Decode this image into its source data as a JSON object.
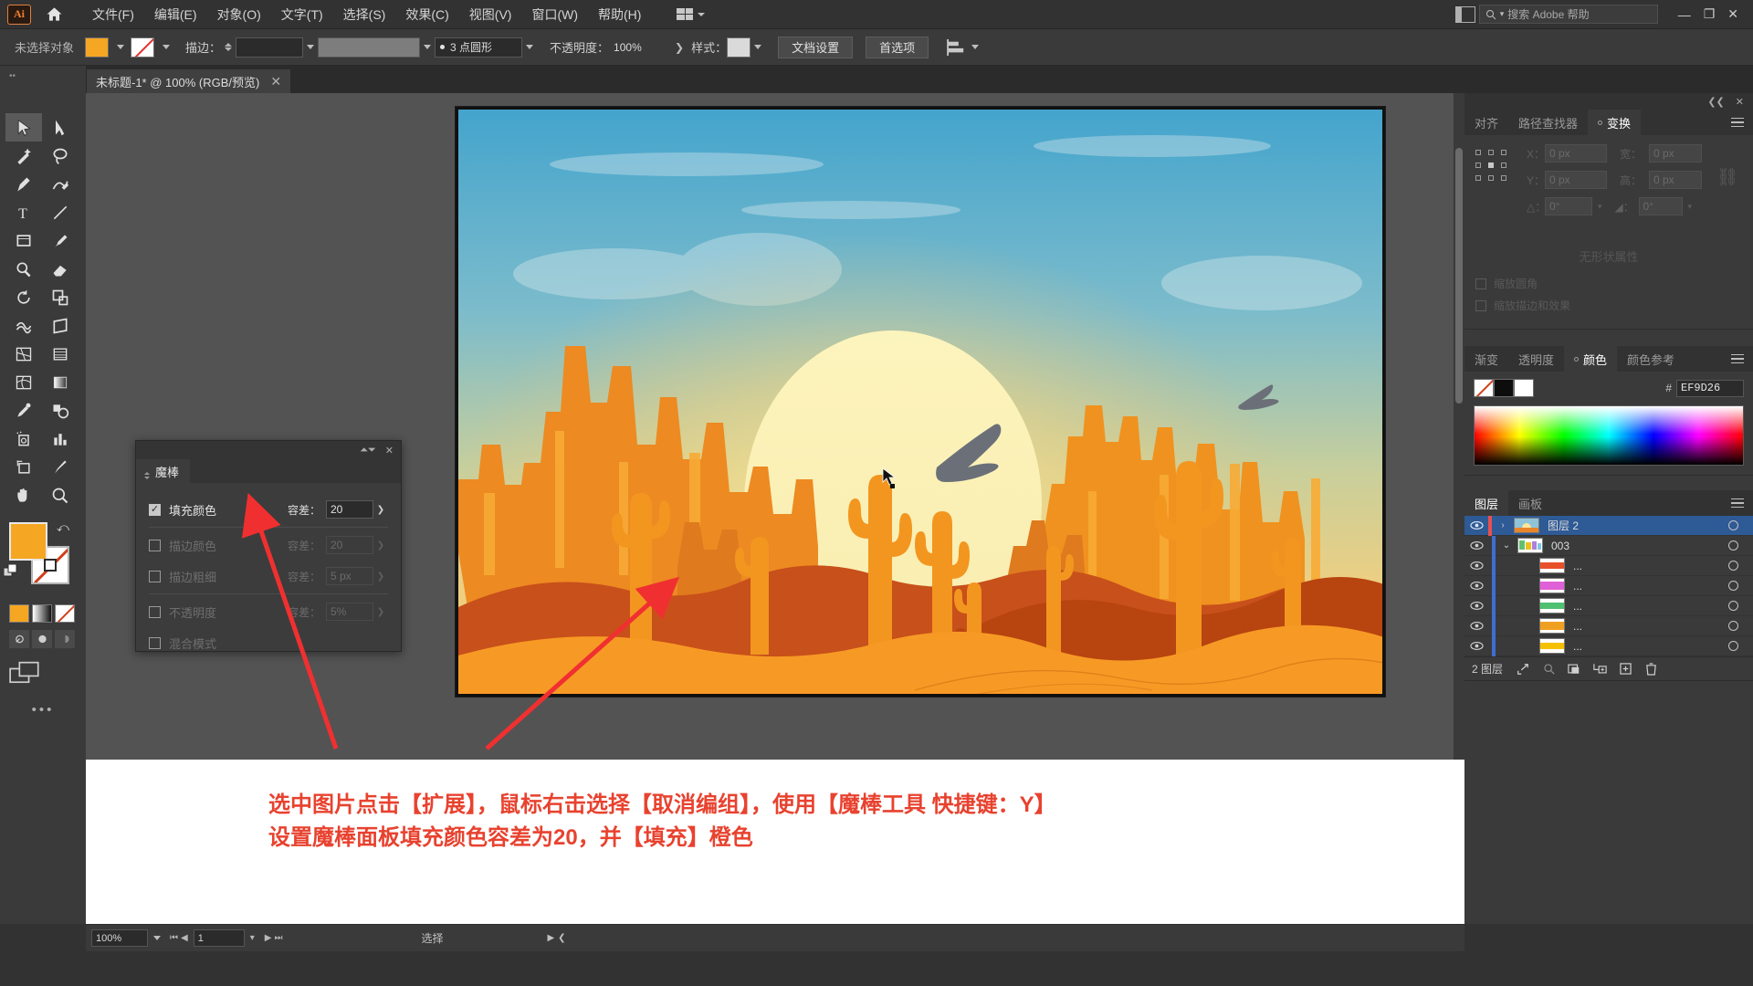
{
  "app": {
    "logo": "Ai",
    "home_icon": "home-icon"
  },
  "menubar": {
    "items": [
      {
        "label": "文件(F)"
      },
      {
        "label": "编辑(E)"
      },
      {
        "label": "对象(O)"
      },
      {
        "label": "文字(T)"
      },
      {
        "label": "选择(S)"
      },
      {
        "label": "效果(C)"
      },
      {
        "label": "视图(V)"
      },
      {
        "label": "窗口(W)"
      },
      {
        "label": "帮助(H)"
      }
    ],
    "search_placeholder": "搜索 Adobe 帮助",
    "minimize": "—",
    "maximize": "❐",
    "close": "✕"
  },
  "controlbar": {
    "selection_status": "未选择对象",
    "fill_color": "#F5A623",
    "stroke_label": "描边：",
    "stroke_weight": "",
    "stroke_profile": "",
    "brush_label": "3 点圆形",
    "opacity_label": "不透明度：",
    "opacity_value": "100%",
    "style_label": "样式：",
    "doc_setup_btn": "文档设置",
    "preferences_btn": "首选项"
  },
  "tabbar": {
    "document_title": "未标题-1* @ 100% (RGB/预览)",
    "close": "✕"
  },
  "toolbar": {
    "tools": [
      {
        "name": "selection-tool",
        "selected": true
      },
      {
        "name": "direct-selection-tool",
        "selected": false
      },
      {
        "name": "magic-wand-tool",
        "selected": false
      },
      {
        "name": "lasso-tool",
        "selected": false
      },
      {
        "name": "pen-tool",
        "selected": false
      },
      {
        "name": "curvature-tool",
        "selected": false
      },
      {
        "name": "type-tool",
        "selected": false
      },
      {
        "name": "line-segment-tool",
        "selected": false
      },
      {
        "name": "rectangle-tool",
        "selected": false
      },
      {
        "name": "paintbrush-tool",
        "selected": false
      },
      {
        "name": "shaper-tool",
        "selected": false
      },
      {
        "name": "eraser-tool",
        "selected": false
      },
      {
        "name": "rotate-tool",
        "selected": false
      },
      {
        "name": "scale-tool",
        "selected": false
      },
      {
        "name": "width-tool",
        "selected": false
      },
      {
        "name": "free-transform-tool",
        "selected": false
      },
      {
        "name": "shape-builder-tool",
        "selected": false
      },
      {
        "name": "perspective-grid-tool",
        "selected": false
      },
      {
        "name": "mesh-tool",
        "selected": false
      },
      {
        "name": "gradient-tool",
        "selected": false
      },
      {
        "name": "eyedropper-tool",
        "selected": false
      },
      {
        "name": "blend-tool",
        "selected": false
      },
      {
        "name": "symbol-sprayer-tool",
        "selected": false
      },
      {
        "name": "column-graph-tool",
        "selected": false
      },
      {
        "name": "artboard-tool",
        "selected": false
      },
      {
        "name": "slice-tool",
        "selected": false
      },
      {
        "name": "hand-tool",
        "selected": false
      },
      {
        "name": "zoom-tool",
        "selected": false
      }
    ],
    "fill_color": "#F5A623",
    "stroke_color": "none",
    "more_tools": "•••"
  },
  "wand_panel": {
    "title": "魔棒",
    "close": "✕",
    "collapse": "⏶⏷",
    "rows": [
      {
        "label": "填充颜色",
        "checked": true,
        "tol_label": "容差：",
        "tol_value": "20",
        "enabled": true
      },
      {
        "label": "描边颜色",
        "checked": false,
        "tol_label": "容差：",
        "tol_value": "20",
        "enabled": false
      },
      {
        "label": "描边粗细",
        "checked": false,
        "tol_label": "容差：",
        "tol_value": "5 px",
        "enabled": false
      },
      {
        "label": "不透明度",
        "checked": false,
        "tol_label": "容差：",
        "tol_value": "5%",
        "enabled": false
      },
      {
        "label": "混合模式",
        "checked": false,
        "tol_label": "",
        "tol_value": "",
        "enabled": false
      }
    ]
  },
  "transform_panel": {
    "tabs": [
      {
        "label": "对齐",
        "active": false
      },
      {
        "label": "路径查找器",
        "active": false
      },
      {
        "label": "变换",
        "active": true
      }
    ],
    "fields": [
      {
        "label": "X：",
        "value": "0 px"
      },
      {
        "label": "宽：",
        "value": "0 px"
      },
      {
        "label": "Y：",
        "value": "0 px"
      },
      {
        "label": "高：",
        "value": "0 px"
      }
    ],
    "angle_label": "△：",
    "angle_value": "0°",
    "shear_label": "◢：",
    "shear_value": "0°",
    "empty_text": "无形状属性",
    "checks": [
      {
        "label": "缩放圆角"
      },
      {
        "label": "缩放描边和效果"
      }
    ]
  },
  "color_panel": {
    "tabs": [
      {
        "label": "渐变",
        "active": false
      },
      {
        "label": "透明度",
        "active": false
      },
      {
        "label": "颜色",
        "active": true
      },
      {
        "label": "颜色参考",
        "active": false
      }
    ],
    "hex_symbol": "#",
    "hex_value": "EF9D26"
  },
  "layers_panel": {
    "tabs": [
      {
        "label": "图层",
        "active": true
      },
      {
        "label": "画板",
        "active": false
      }
    ],
    "rows": [
      {
        "name": "图层 2",
        "selected": true,
        "color": "#e85050",
        "indent": 0,
        "twirl": "›",
        "thumb": "sunset",
        "has_thumb": true
      },
      {
        "name": "003",
        "selected": false,
        "color": "#3c6fd0",
        "indent": 1,
        "twirl": "⌄",
        "thumb": "group",
        "has_thumb": true
      },
      {
        "name": "...",
        "selected": false,
        "color": "#3c6fd0",
        "indent": 2,
        "twirl": "",
        "thumb": "#e8502a",
        "has_thumb": true
      },
      {
        "name": "...",
        "selected": false,
        "color": "#3c6fd0",
        "indent": 2,
        "twirl": "",
        "thumb": "#e060d8",
        "has_thumb": true
      },
      {
        "name": "...",
        "selected": false,
        "color": "#3c6fd0",
        "indent": 2,
        "twirl": "",
        "thumb": "#4fc070",
        "has_thumb": true
      },
      {
        "name": "...",
        "selected": false,
        "color": "#3c6fd0",
        "indent": 2,
        "twirl": "",
        "thumb": "#f0a020",
        "has_thumb": true
      },
      {
        "name": "...",
        "selected": false,
        "color": "#3c6fd0",
        "indent": 2,
        "twirl": "",
        "thumb": "#f5c000",
        "has_thumb": true
      }
    ],
    "footer_count": "2 图层",
    "footer_icons": [
      "locate-object-icon",
      "make-clipping-mask-icon",
      "create-sublayer-icon",
      "create-new-layer-icon",
      "delete-selection-icon"
    ]
  },
  "annotation": {
    "line1": "选中图片点击【扩展】，鼠标右击选择【取消编组】，使用【魔棒工具 快捷键：Y】",
    "line2": "设置魔棒面板填充颜色容差为20，并【填充】橙色",
    "color": "#e8422f"
  },
  "statusbar": {
    "zoom": "100%",
    "page": "1",
    "tool_status": "选择",
    "nav_first": "⏮",
    "nav_prev": "◀",
    "nav_next": "▶",
    "nav_last": "⏭"
  },
  "artwork": {
    "description": "desert-sunset-illustration",
    "sky_top": "#4aa8d0",
    "sky_glow": "#f5d98a",
    "sun": "#f9f0b0",
    "mesa": "#f08a2a",
    "dune_dark": "#c24a18",
    "sand": "#f79a25"
  }
}
